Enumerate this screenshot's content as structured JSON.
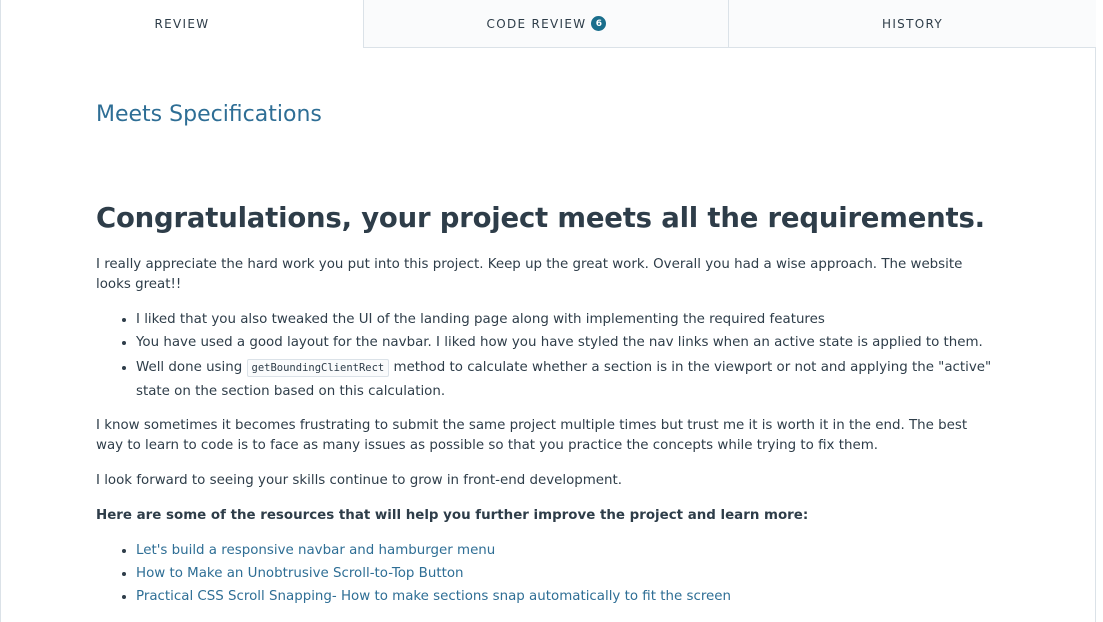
{
  "tabs": {
    "review": "REVIEW",
    "code_review": "CODE REVIEW",
    "code_review_count": "6",
    "history": "HISTORY"
  },
  "review": {
    "status": "Meets Specifications",
    "headline": "Congratulations, your project meets all the requirements.",
    "intro": "I really appreciate the hard work you put into this project. Keep up the great work. Overall you had a wise approach. The website looks great!!",
    "points": [
      "I liked that you also tweaked the UI of the landing page along with implementing the required features",
      "You have used a good layout for the navbar. I liked how you have styled the nav links when an active state is applied to them."
    ],
    "point3_before": "Well done using ",
    "point3_code": "getBoundingClientRect",
    "point3_after": " method to calculate whether a section is in the viewport or not and applying the \"active\" state on the section based on this calculation.",
    "paragraph2": "I know sometimes it becomes frustrating to submit the same project multiple times but trust me it is worth it in the end. The best way to learn to code is to face as many issues as possible so that you practice the concepts while trying to fix them.",
    "paragraph3": "I look forward to seeing your skills continue to grow in front-end development.",
    "resources_heading": "Here are some of the resources that will help you further improve the project and learn more:",
    "resources": [
      "Let's build a responsive navbar and hamburger menu",
      "How to Make an Unobtrusive Scroll-to-Top Button",
      "Practical CSS Scroll Snapping- How to make sections snap automatically to fit the screen"
    ]
  },
  "colors": {
    "accent": "#2e6e95",
    "badge": "#1a6e8c",
    "text": "#2e3d49"
  }
}
